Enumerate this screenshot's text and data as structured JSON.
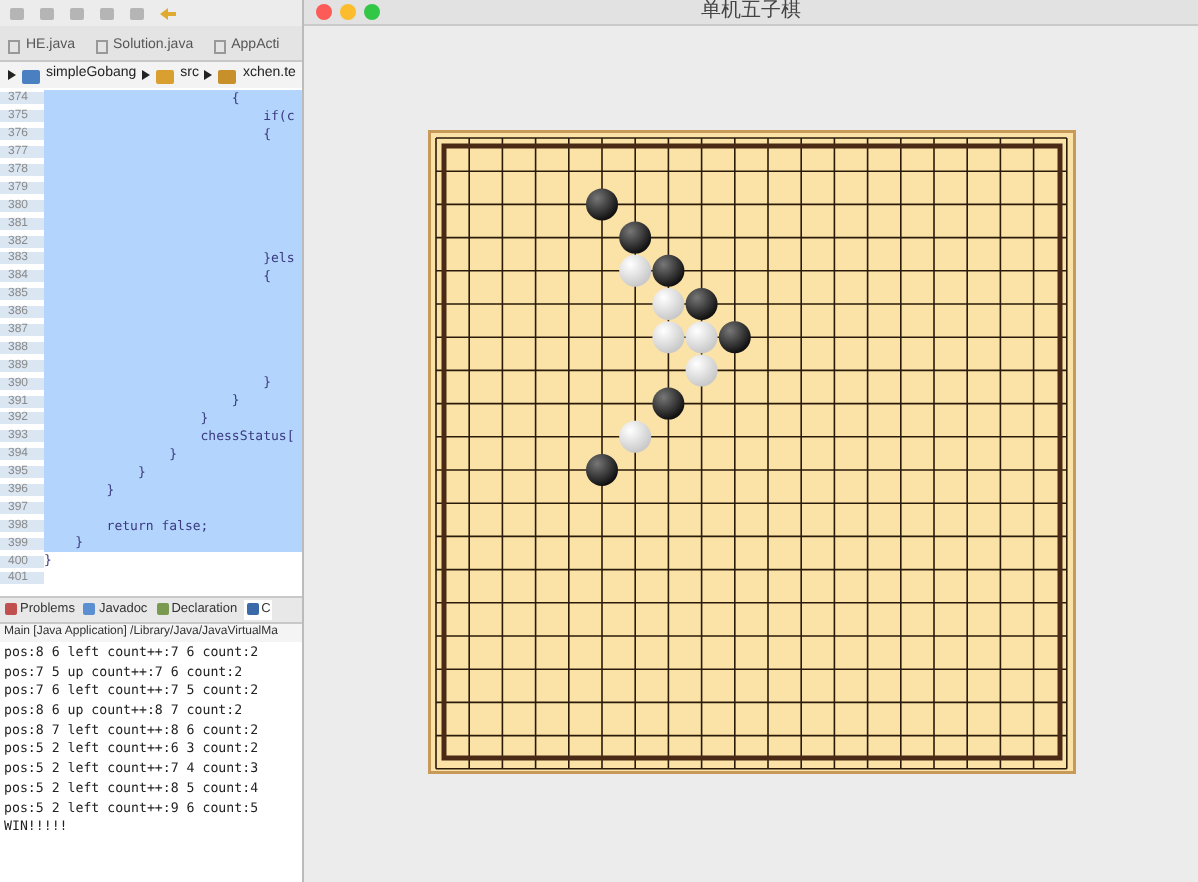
{
  "editor": {
    "tabs": [
      {
        "label": "HE.java",
        "selected": false
      },
      {
        "label": "Solution.java",
        "selected": false
      },
      {
        "label": "AppActi",
        "selected": false
      }
    ],
    "breadcrumb": [
      {
        "label": "simpleGobang",
        "kind": "project"
      },
      {
        "label": "src",
        "kind": "folder"
      },
      {
        "label": "xchen.te",
        "kind": "package"
      }
    ],
    "lines": [
      {
        "number": "374",
        "code": "                        {",
        "selected": true
      },
      {
        "number": "375",
        "code": "                            if(c",
        "selected": true
      },
      {
        "number": "376",
        "code": "                            {",
        "selected": true
      },
      {
        "number": "377",
        "selected": true
      },
      {
        "number": "378",
        "selected": true
      },
      {
        "number": "379",
        "selected": true
      },
      {
        "number": "380",
        "selected": true
      },
      {
        "number": "381",
        "selected": true
      },
      {
        "number": "382",
        "selected": true
      },
      {
        "number": "383",
        "code": "                            }els",
        "selected": true
      },
      {
        "number": "384",
        "code": "                            {",
        "selected": true
      },
      {
        "number": "385",
        "selected": true
      },
      {
        "number": "386",
        "selected": true
      },
      {
        "number": "387",
        "selected": true
      },
      {
        "number": "388",
        "selected": true
      },
      {
        "number": "389",
        "selected": true
      },
      {
        "number": "390",
        "code": "                            }",
        "selected": true
      },
      {
        "number": "391",
        "code": "                        }",
        "selected": true
      },
      {
        "number": "392",
        "code": "                    }",
        "selected": true
      },
      {
        "number": "393",
        "code": "                    chessStatus[",
        "selected": true
      },
      {
        "number": "394",
        "code": "                }",
        "selected": true
      },
      {
        "number": "395",
        "code": "            }",
        "selected": true
      },
      {
        "number": "396",
        "code": "        }",
        "selected": true
      },
      {
        "number": "397",
        "selected": true
      },
      {
        "number": "398",
        "code": "        return false;",
        "selected": true
      },
      {
        "number": "399",
        "code": "    }",
        "selected": true
      },
      {
        "number": "400",
        "code": "}",
        "selected": false
      },
      {
        "number": "401",
        "selected": false
      }
    ]
  },
  "bottom_panel": {
    "tabs": [
      {
        "label": "Problems",
        "kind": "problems",
        "selected": false
      },
      {
        "label": "Javadoc",
        "kind": "javadoc",
        "selected": false
      },
      {
        "label": "Declaration",
        "kind": "declaration",
        "selected": false
      },
      {
        "label": "C",
        "kind": "console",
        "selected": true
      }
    ],
    "console_header": "Main [Java Application] /Library/Java/JavaVirtualMa",
    "console_lines": [
      "pos:8 6 left count++:7 6 count:2",
      "pos:7 5 up count++:7 6 count:2",
      "pos:7 6 left count++:7 5 count:2",
      "pos:8 6 up count++:8 7 count:2",
      "pos:8 7 left count++:8 6 count:2",
      "pos:5 2 left count++:6 3 count:2",
      "pos:5 2 left count++:7 4 count:3",
      "pos:5 2 left count++:8 5 count:4",
      "pos:5 2 left count++:9 6 count:5",
      "WIN!!!!!"
    ]
  },
  "game_window": {
    "title": "单机五子棋",
    "board": {
      "rows": [
        {
          "cells": [
            {
              "kind": "empty"
            },
            {
              "kind": "empty"
            },
            {
              "kind": "empty"
            },
            {
              "kind": "empty"
            },
            {
              "kind": "empty"
            },
            {
              "kind": "empty"
            },
            {
              "kind": "empty"
            },
            {
              "kind": "empty"
            },
            {
              "kind": "empty"
            },
            {
              "kind": "empty"
            },
            {
              "kind": "empty"
            },
            {
              "kind": "empty"
            },
            {
              "kind": "empty"
            },
            {
              "kind": "empty"
            },
            {
              "kind": "empty"
            },
            {
              "kind": "empty"
            },
            {
              "kind": "empty"
            },
            {
              "kind": "empty"
            },
            {
              "kind": "empty"
            },
            {
              "kind": "empty"
            }
          ]
        },
        {
          "cells": [
            {
              "kind": "empty"
            },
            {
              "kind": "empty"
            },
            {
              "kind": "empty"
            },
            {
              "kind": "empty"
            },
            {
              "kind": "empty"
            },
            {
              "kind": "empty"
            },
            {
              "kind": "empty"
            },
            {
              "kind": "empty"
            },
            {
              "kind": "empty"
            },
            {
              "kind": "empty"
            },
            {
              "kind": "empty"
            },
            {
              "kind": "empty"
            },
            {
              "kind": "empty"
            },
            {
              "kind": "empty"
            },
            {
              "kind": "empty"
            },
            {
              "kind": "empty"
            },
            {
              "kind": "empty"
            },
            {
              "kind": "empty"
            },
            {
              "kind": "empty"
            },
            {
              "kind": "empty"
            }
          ]
        },
        {
          "cells": [
            {
              "kind": "empty"
            },
            {
              "kind": "empty"
            },
            {
              "kind": "empty"
            },
            {
              "kind": "empty"
            },
            {
              "kind": "empty"
            },
            {
              "kind": "black"
            },
            {
              "kind": "empty"
            },
            {
              "kind": "empty"
            },
            {
              "kind": "empty"
            },
            {
              "kind": "empty"
            },
            {
              "kind": "empty"
            },
            {
              "kind": "empty"
            },
            {
              "kind": "empty"
            },
            {
              "kind": "empty"
            },
            {
              "kind": "empty"
            },
            {
              "kind": "empty"
            },
            {
              "kind": "empty"
            },
            {
              "kind": "empty"
            },
            {
              "kind": "empty"
            },
            {
              "kind": "empty"
            }
          ]
        },
        {
          "cells": [
            {
              "kind": "empty"
            },
            {
              "kind": "empty"
            },
            {
              "kind": "empty"
            },
            {
              "kind": "empty"
            },
            {
              "kind": "empty"
            },
            {
              "kind": "empty"
            },
            {
              "kind": "black"
            },
            {
              "kind": "empty"
            },
            {
              "kind": "empty"
            },
            {
              "kind": "empty"
            },
            {
              "kind": "empty"
            },
            {
              "kind": "empty"
            },
            {
              "kind": "empty"
            },
            {
              "kind": "empty"
            },
            {
              "kind": "empty"
            },
            {
              "kind": "empty"
            },
            {
              "kind": "empty"
            },
            {
              "kind": "empty"
            },
            {
              "kind": "empty"
            },
            {
              "kind": "empty"
            }
          ]
        },
        {
          "cells": [
            {
              "kind": "empty"
            },
            {
              "kind": "empty"
            },
            {
              "kind": "empty"
            },
            {
              "kind": "empty"
            },
            {
              "kind": "empty"
            },
            {
              "kind": "empty"
            },
            {
              "kind": "white"
            },
            {
              "kind": "black"
            },
            {
              "kind": "empty"
            },
            {
              "kind": "empty"
            },
            {
              "kind": "empty"
            },
            {
              "kind": "empty"
            },
            {
              "kind": "empty"
            },
            {
              "kind": "empty"
            },
            {
              "kind": "empty"
            },
            {
              "kind": "empty"
            },
            {
              "kind": "empty"
            },
            {
              "kind": "empty"
            },
            {
              "kind": "empty"
            },
            {
              "kind": "empty"
            }
          ]
        },
        {
          "cells": [
            {
              "kind": "empty"
            },
            {
              "kind": "empty"
            },
            {
              "kind": "empty"
            },
            {
              "kind": "empty"
            },
            {
              "kind": "empty"
            },
            {
              "kind": "empty"
            },
            {
              "kind": "empty"
            },
            {
              "kind": "white"
            },
            {
              "kind": "black"
            },
            {
              "kind": "empty"
            },
            {
              "kind": "empty"
            },
            {
              "kind": "empty"
            },
            {
              "kind": "empty"
            },
            {
              "kind": "empty"
            },
            {
              "kind": "empty"
            },
            {
              "kind": "empty"
            },
            {
              "kind": "empty"
            },
            {
              "kind": "empty"
            },
            {
              "kind": "empty"
            },
            {
              "kind": "empty"
            }
          ]
        },
        {
          "cells": [
            {
              "kind": "empty"
            },
            {
              "kind": "empty"
            },
            {
              "kind": "empty"
            },
            {
              "kind": "empty"
            },
            {
              "kind": "empty"
            },
            {
              "kind": "empty"
            },
            {
              "kind": "empty"
            },
            {
              "kind": "white"
            },
            {
              "kind": "white"
            },
            {
              "kind": "black"
            },
            {
              "kind": "empty"
            },
            {
              "kind": "empty"
            },
            {
              "kind": "empty"
            },
            {
              "kind": "empty"
            },
            {
              "kind": "empty"
            },
            {
              "kind": "empty"
            },
            {
              "kind": "empty"
            },
            {
              "kind": "empty"
            },
            {
              "kind": "empty"
            },
            {
              "kind": "empty"
            }
          ]
        },
        {
          "cells": [
            {
              "kind": "empty"
            },
            {
              "kind": "empty"
            },
            {
              "kind": "empty"
            },
            {
              "kind": "empty"
            },
            {
              "kind": "empty"
            },
            {
              "kind": "empty"
            },
            {
              "kind": "empty"
            },
            {
              "kind": "empty"
            },
            {
              "kind": "white"
            },
            {
              "kind": "empty"
            },
            {
              "kind": "empty"
            },
            {
              "kind": "empty"
            },
            {
              "kind": "empty"
            },
            {
              "kind": "empty"
            },
            {
              "kind": "empty"
            },
            {
              "kind": "empty"
            },
            {
              "kind": "empty"
            },
            {
              "kind": "empty"
            },
            {
              "kind": "empty"
            },
            {
              "kind": "empty"
            }
          ]
        },
        {
          "cells": [
            {
              "kind": "empty"
            },
            {
              "kind": "empty"
            },
            {
              "kind": "empty"
            },
            {
              "kind": "empty"
            },
            {
              "kind": "empty"
            },
            {
              "kind": "empty"
            },
            {
              "kind": "empty"
            },
            {
              "kind": "black"
            },
            {
              "kind": "empty"
            },
            {
              "kind": "empty"
            },
            {
              "kind": "empty"
            },
            {
              "kind": "empty"
            },
            {
              "kind": "empty"
            },
            {
              "kind": "empty"
            },
            {
              "kind": "empty"
            },
            {
              "kind": "empty"
            },
            {
              "kind": "empty"
            },
            {
              "kind": "empty"
            },
            {
              "kind": "empty"
            },
            {
              "kind": "empty"
            }
          ]
        },
        {
          "cells": [
            {
              "kind": "empty"
            },
            {
              "kind": "empty"
            },
            {
              "kind": "empty"
            },
            {
              "kind": "empty"
            },
            {
              "kind": "empty"
            },
            {
              "kind": "empty"
            },
            {
              "kind": "white"
            },
            {
              "kind": "empty"
            },
            {
              "kind": "empty"
            },
            {
              "kind": "empty"
            },
            {
              "kind": "empty"
            },
            {
              "kind": "empty"
            },
            {
              "kind": "empty"
            },
            {
              "kind": "empty"
            },
            {
              "kind": "empty"
            },
            {
              "kind": "empty"
            },
            {
              "kind": "empty"
            },
            {
              "kind": "empty"
            },
            {
              "kind": "empty"
            },
            {
              "kind": "empty"
            }
          ]
        },
        {
          "cells": [
            {
              "kind": "empty"
            },
            {
              "kind": "empty"
            },
            {
              "kind": "empty"
            },
            {
              "kind": "empty"
            },
            {
              "kind": "empty"
            },
            {
              "kind": "black"
            },
            {
              "kind": "empty"
            },
            {
              "kind": "empty"
            },
            {
              "kind": "empty"
            },
            {
              "kind": "empty"
            },
            {
              "kind": "empty"
            },
            {
              "kind": "empty"
            },
            {
              "kind": "empty"
            },
            {
              "kind": "empty"
            },
            {
              "kind": "empty"
            },
            {
              "kind": "empty"
            },
            {
              "kind": "empty"
            },
            {
              "kind": "empty"
            },
            {
              "kind": "empty"
            },
            {
              "kind": "empty"
            }
          ]
        },
        {
          "cells": [
            {
              "kind": "empty"
            },
            {
              "kind": "empty"
            },
            {
              "kind": "empty"
            },
            {
              "kind": "empty"
            },
            {
              "kind": "empty"
            },
            {
              "kind": "empty"
            },
            {
              "kind": "empty"
            },
            {
              "kind": "empty"
            },
            {
              "kind": "empty"
            },
            {
              "kind": "empty"
            },
            {
              "kind": "empty"
            },
            {
              "kind": "empty"
            },
            {
              "kind": "empty"
            },
            {
              "kind": "empty"
            },
            {
              "kind": "empty"
            },
            {
              "kind": "empty"
            },
            {
              "kind": "empty"
            },
            {
              "kind": "empty"
            },
            {
              "kind": "empty"
            },
            {
              "kind": "empty"
            }
          ]
        },
        {
          "cells": [
            {
              "kind": "empty"
            },
            {
              "kind": "empty"
            },
            {
              "kind": "empty"
            },
            {
              "kind": "empty"
            },
            {
              "kind": "empty"
            },
            {
              "kind": "empty"
            },
            {
              "kind": "empty"
            },
            {
              "kind": "empty"
            },
            {
              "kind": "empty"
            },
            {
              "kind": "empty"
            },
            {
              "kind": "empty"
            },
            {
              "kind": "empty"
            },
            {
              "kind": "empty"
            },
            {
              "kind": "empty"
            },
            {
              "kind": "empty"
            },
            {
              "kind": "empty"
            },
            {
              "kind": "empty"
            },
            {
              "kind": "empty"
            },
            {
              "kind": "empty"
            },
            {
              "kind": "empty"
            }
          ]
        },
        {
          "cells": [
            {
              "kind": "empty"
            },
            {
              "kind": "empty"
            },
            {
              "kind": "empty"
            },
            {
              "kind": "empty"
            },
            {
              "kind": "empty"
            },
            {
              "kind": "empty"
            },
            {
              "kind": "empty"
            },
            {
              "kind": "empty"
            },
            {
              "kind": "empty"
            },
            {
              "kind": "empty"
            },
            {
              "kind": "empty"
            },
            {
              "kind": "empty"
            },
            {
              "kind": "empty"
            },
            {
              "kind": "empty"
            },
            {
              "kind": "empty"
            },
            {
              "kind": "empty"
            },
            {
              "kind": "empty"
            },
            {
              "kind": "empty"
            },
            {
              "kind": "empty"
            },
            {
              "kind": "empty"
            }
          ]
        },
        {
          "cells": [
            {
              "kind": "empty"
            },
            {
              "kind": "empty"
            },
            {
              "kind": "empty"
            },
            {
              "kind": "empty"
            },
            {
              "kind": "empty"
            },
            {
              "kind": "empty"
            },
            {
              "kind": "empty"
            },
            {
              "kind": "empty"
            },
            {
              "kind": "empty"
            },
            {
              "kind": "empty"
            },
            {
              "kind": "empty"
            },
            {
              "kind": "empty"
            },
            {
              "kind": "empty"
            },
            {
              "kind": "empty"
            },
            {
              "kind": "empty"
            },
            {
              "kind": "empty"
            },
            {
              "kind": "empty"
            },
            {
              "kind": "empty"
            },
            {
              "kind": "empty"
            },
            {
              "kind": "empty"
            }
          ]
        },
        {
          "cells": [
            {
              "kind": "empty"
            },
            {
              "kind": "empty"
            },
            {
              "kind": "empty"
            },
            {
              "kind": "empty"
            },
            {
              "kind": "empty"
            },
            {
              "kind": "empty"
            },
            {
              "kind": "empty"
            },
            {
              "kind": "empty"
            },
            {
              "kind": "empty"
            },
            {
              "kind": "empty"
            },
            {
              "kind": "empty"
            },
            {
              "kind": "empty"
            },
            {
              "kind": "empty"
            },
            {
              "kind": "empty"
            },
            {
              "kind": "empty"
            },
            {
              "kind": "empty"
            },
            {
              "kind": "empty"
            },
            {
              "kind": "empty"
            },
            {
              "kind": "empty"
            },
            {
              "kind": "empty"
            }
          ]
        },
        {
          "cells": [
            {
              "kind": "empty"
            },
            {
              "kind": "empty"
            },
            {
              "kind": "empty"
            },
            {
              "kind": "empty"
            },
            {
              "kind": "empty"
            },
            {
              "kind": "empty"
            },
            {
              "kind": "empty"
            },
            {
              "kind": "empty"
            },
            {
              "kind": "empty"
            },
            {
              "kind": "empty"
            },
            {
              "kind": "empty"
            },
            {
              "kind": "empty"
            },
            {
              "kind": "empty"
            },
            {
              "kind": "empty"
            },
            {
              "kind": "empty"
            },
            {
              "kind": "empty"
            },
            {
              "kind": "empty"
            },
            {
              "kind": "empty"
            },
            {
              "kind": "empty"
            },
            {
              "kind": "empty"
            }
          ]
        },
        {
          "cells": [
            {
              "kind": "empty"
            },
            {
              "kind": "empty"
            },
            {
              "kind": "empty"
            },
            {
              "kind": "empty"
            },
            {
              "kind": "empty"
            },
            {
              "kind": "empty"
            },
            {
              "kind": "empty"
            },
            {
              "kind": "empty"
            },
            {
              "kind": "empty"
            },
            {
              "kind": "empty"
            },
            {
              "kind": "empty"
            },
            {
              "kind": "empty"
            },
            {
              "kind": "empty"
            },
            {
              "kind": "empty"
            },
            {
              "kind": "empty"
            },
            {
              "kind": "empty"
            },
            {
              "kind": "empty"
            },
            {
              "kind": "empty"
            },
            {
              "kind": "empty"
            },
            {
              "kind": "empty"
            }
          ]
        },
        {
          "cells": [
            {
              "kind": "empty"
            },
            {
              "kind": "empty"
            },
            {
              "kind": "empty"
            },
            {
              "kind": "empty"
            },
            {
              "kind": "empty"
            },
            {
              "kind": "empty"
            },
            {
              "kind": "empty"
            },
            {
              "kind": "empty"
            },
            {
              "kind": "empty"
            },
            {
              "kind": "empty"
            },
            {
              "kind": "empty"
            },
            {
              "kind": "empty"
            },
            {
              "kind": "empty"
            },
            {
              "kind": "empty"
            },
            {
              "kind": "empty"
            },
            {
              "kind": "empty"
            },
            {
              "kind": "empty"
            },
            {
              "kind": "empty"
            },
            {
              "kind": "empty"
            },
            {
              "kind": "empty"
            }
          ]
        },
        {
          "cells": [
            {
              "kind": "empty"
            },
            {
              "kind": "empty"
            },
            {
              "kind": "empty"
            },
            {
              "kind": "empty"
            },
            {
              "kind": "empty"
            },
            {
              "kind": "empty"
            },
            {
              "kind": "empty"
            },
            {
              "kind": "empty"
            },
            {
              "kind": "empty"
            },
            {
              "kind": "empty"
            },
            {
              "kind": "empty"
            },
            {
              "kind": "empty"
            },
            {
              "kind": "empty"
            },
            {
              "kind": "empty"
            },
            {
              "kind": "empty"
            },
            {
              "kind": "empty"
            },
            {
              "kind": "empty"
            },
            {
              "kind": "empty"
            },
            {
              "kind": "empty"
            },
            {
              "kind": "empty"
            }
          ]
        }
      ]
    }
  }
}
